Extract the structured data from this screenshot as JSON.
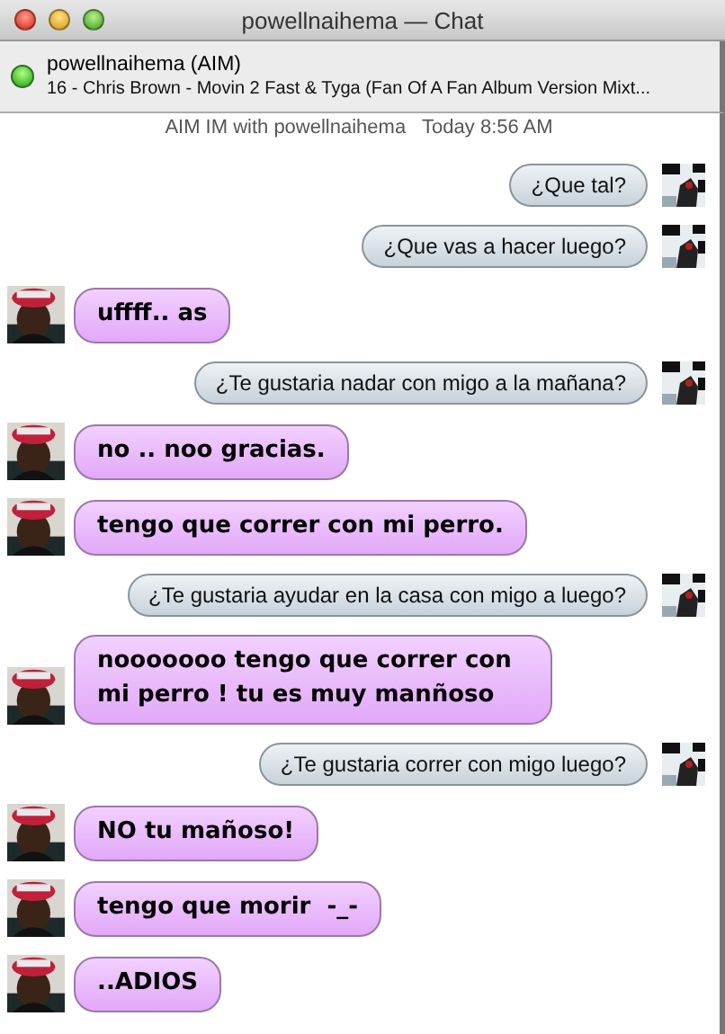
{
  "window": {
    "title": "powellnaihema — Chat"
  },
  "buddy": {
    "name": "powellnaihema (AIM)",
    "status": "16 - Chris Brown - Movin 2 Fast & Tyga (Fan Of A Fan Album Version Mixt...",
    "online": true
  },
  "session_header": "AIM IM with powellnaihema   Today 8:56 AM",
  "messages": [
    {
      "kind": "outgoing",
      "text": "¿Que tal?"
    },
    {
      "kind": "outgoing",
      "text": "¿Que vas a hacer luego?"
    },
    {
      "kind": "incoming",
      "text": "uffff.. as"
    },
    {
      "kind": "outgoing",
      "text": "¿Te gustaria nadar con migo a la mañana?"
    },
    {
      "kind": "incoming",
      "text": "no .. noo gracias."
    },
    {
      "kind": "incoming",
      "text": "tengo que correr con mi perro."
    },
    {
      "kind": "outgoing",
      "text": "¿Te gustaria ayudar en la casa con migo a luego?"
    },
    {
      "kind": "incoming",
      "text": "nooooooo tengo que correr con mi perro ! tu es muy manñoso"
    },
    {
      "kind": "outgoing",
      "text": "¿Te gustaria correr con migo luego?"
    },
    {
      "kind": "incoming",
      "text": "NO tu mañoso!"
    },
    {
      "kind": "incoming",
      "text": "tengo que morir  -_-"
    },
    {
      "kind": "incoming",
      "text": "..ADIOS"
    }
  ]
}
